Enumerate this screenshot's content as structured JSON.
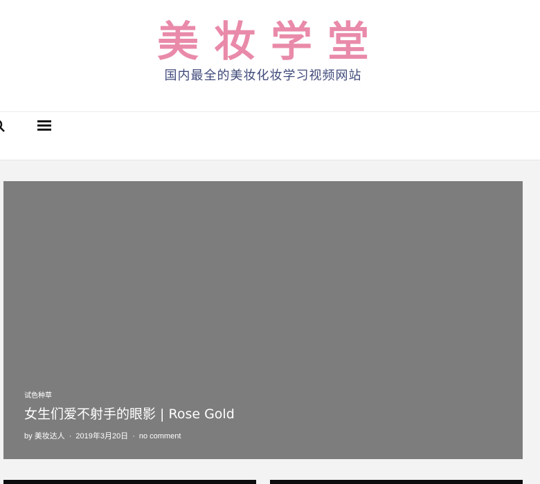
{
  "header": {
    "logo_title": "美妆学堂",
    "logo_tagline": "国内最全的美妆化妆学习视频网站"
  },
  "nav": {
    "search_icon": "search-icon",
    "menu_icon": "menu-icon"
  },
  "featured_post": {
    "category": "试色种草",
    "title": "女生们爱不射手的眼影 | Rose Gold",
    "author_prefix": "by",
    "author": "美妆达人",
    "date": "2019年3月20日",
    "comments": "no comment",
    "separator": "·"
  },
  "colors": {
    "logo_pink": "#e98aa9",
    "tagline_navy": "#3f4a7a",
    "feature_overlay": "#7d7d7d"
  }
}
